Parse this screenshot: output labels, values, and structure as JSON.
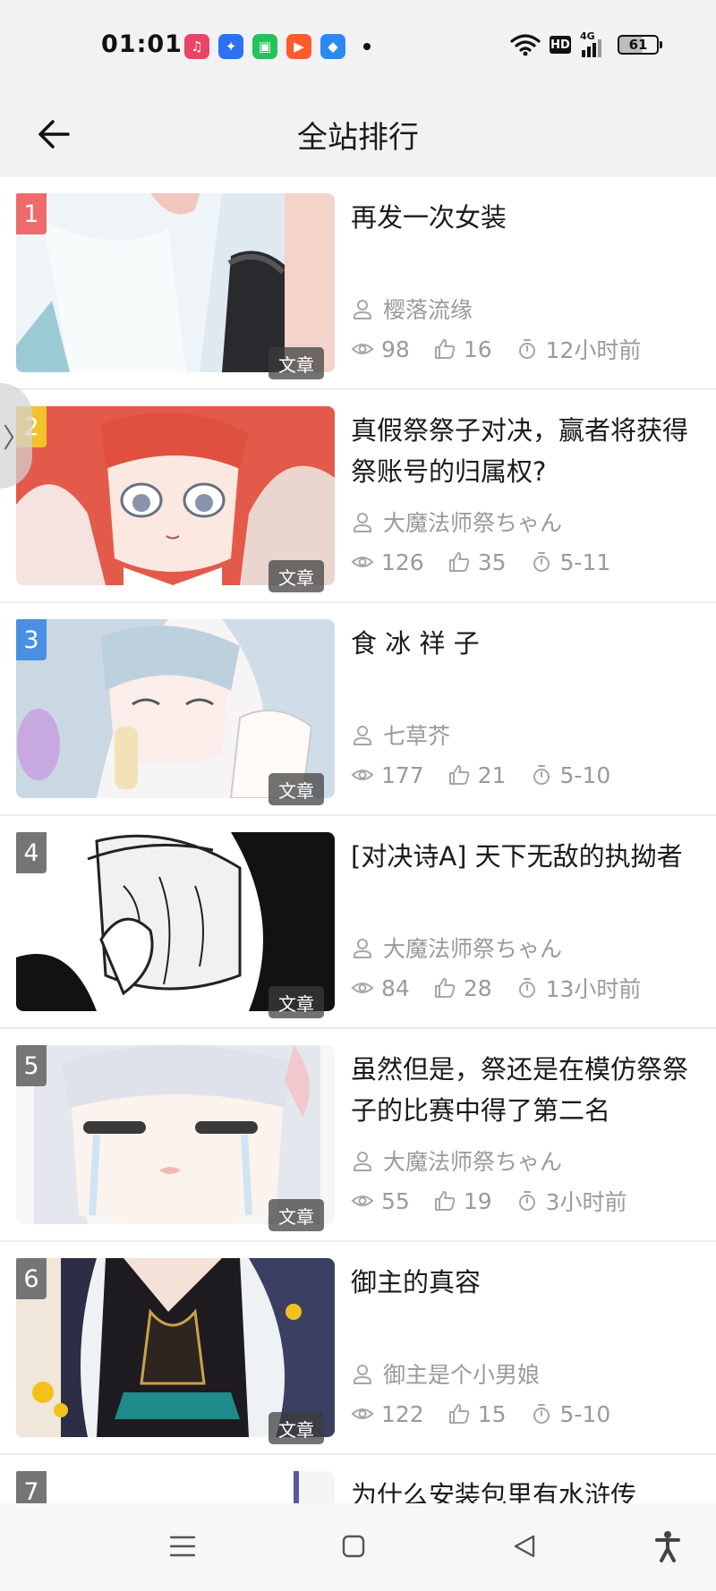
{
  "status_bar": {
    "time": "01:01",
    "battery": "61",
    "network_badge": "HD",
    "network_type": "4G",
    "app_icons": [
      {
        "name": "music-app-icon",
        "color": "#ea4466"
      },
      {
        "name": "baidu-app-icon",
        "color": "#2f6ff2"
      },
      {
        "name": "store-app-icon",
        "color": "#24c35a"
      },
      {
        "name": "video-app-icon",
        "color": "#ff5a2c"
      },
      {
        "name": "blue-app-icon",
        "color": "#2d89f2"
      }
    ]
  },
  "header": {
    "title": "全站排行",
    "back_icon": "back-arrow-icon"
  },
  "items": [
    {
      "rank": "1",
      "rank_color": "#ef6b6b",
      "type": "文章",
      "title": "再发一次女装",
      "author": "樱落流缘",
      "views": "98",
      "likes": "16",
      "time": "12小时前"
    },
    {
      "rank": "2",
      "rank_color": "#f2c12e",
      "type": "文章",
      "title": "真假祭祭子对决，赢者将获得祭账号的归属权?",
      "author": "大魔法师祭ちゃん",
      "views": "126",
      "likes": "35",
      "time": "5-11"
    },
    {
      "rank": "3",
      "rank_color": "#4a90e2",
      "type": "文章",
      "title": "食 冰 祥 子",
      "author": "七草芥",
      "views": "177",
      "likes": "21",
      "time": "5-10"
    },
    {
      "rank": "4",
      "rank_color": "#757575",
      "type": "文章",
      "title": "[对决诗A] 天下无敌的执拗者",
      "author": "大魔法师祭ちゃん",
      "views": "84",
      "likes": "28",
      "time": "13小时前"
    },
    {
      "rank": "5",
      "rank_color": "#757575",
      "type": "文章",
      "title": "虽然但是，祭还是在模仿祭祭子的比赛中得了第二名",
      "author": "大魔法师祭ちゃん",
      "views": "55",
      "likes": "19",
      "time": "3小时前"
    },
    {
      "rank": "6",
      "rank_color": "#757575",
      "type": "文章",
      "title": "御主的真容",
      "author": "御主是个小男娘",
      "views": "122",
      "likes": "15",
      "time": "5-10"
    },
    {
      "rank": "7",
      "rank_color": "#757575",
      "title": "为什么安装包里有水浒传"
    }
  ],
  "side_handle": {
    "label": "〉"
  },
  "nav_bar": {
    "icons": [
      "menu-icon",
      "home-square-icon",
      "back-triangle-icon",
      "accessibility-icon"
    ]
  }
}
